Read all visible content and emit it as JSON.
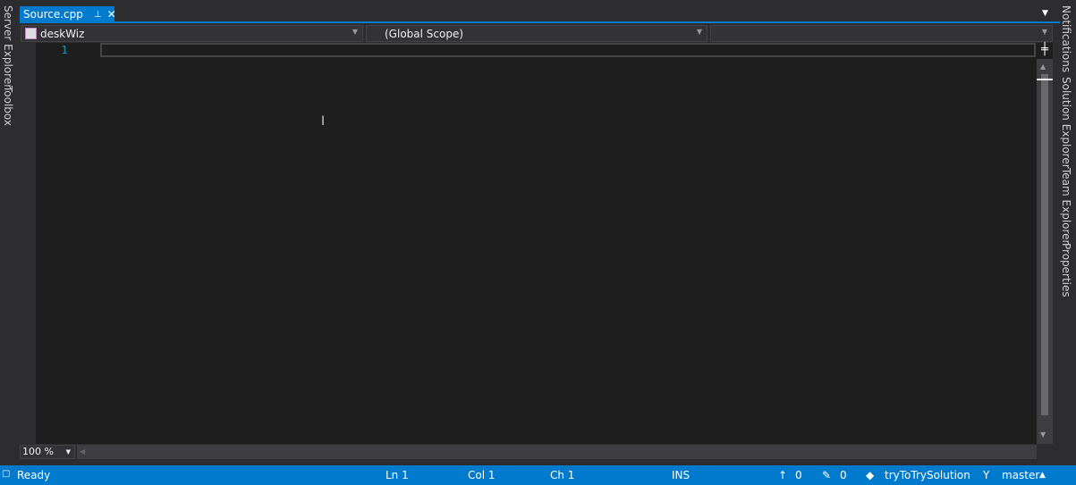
{
  "left_panel": [
    "Server Explorer",
    "Toolbox"
  ],
  "right_panel": [
    "Notifications",
    "Solution Explorer",
    "Team Explorer",
    "Properties"
  ],
  "tab": {
    "label": "Source.cpp",
    "pin": "⊥",
    "close": "✕"
  },
  "nav": {
    "project": "deskWiz",
    "scope": "(Global Scope)",
    "member": ""
  },
  "editor": {
    "line_number": "1"
  },
  "zoom": "100 %",
  "status": {
    "ready": "Ready",
    "ln": "Ln 1",
    "col": "Col 1",
    "ch": "Ch 1",
    "mode": "INS",
    "up": "0",
    "pending": "0",
    "repo": "tryToTrySolution",
    "branch": "master"
  }
}
